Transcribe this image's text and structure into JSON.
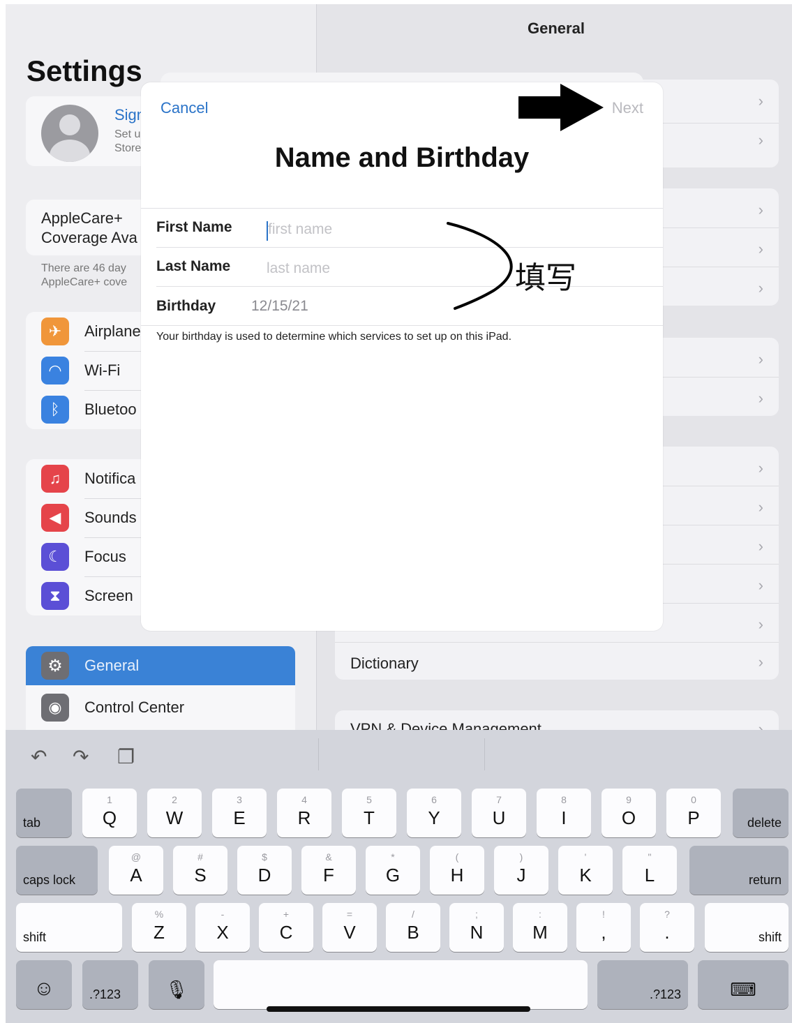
{
  "settings": {
    "title": "Settings",
    "account": {
      "title_partial": "Sign",
      "line1_partial": "Set u",
      "line2_partial": "Store"
    },
    "applecare": {
      "line1": "AppleCare+",
      "line2_partial": "Coverage Ava",
      "note1_partial": "There are 46 day",
      "note2_partial": "AppleCare+ cove"
    },
    "group1": [
      {
        "label": "Airplane",
        "icon": "airplane-icon",
        "color": "#f0963a",
        "glyph": "✈"
      },
      {
        "label": "Wi-Fi",
        "icon": "wifi-icon",
        "color": "#3a82e0",
        "glyph": "◠"
      },
      {
        "label": "Bluetoo",
        "icon": "bluetooth-icon",
        "color": "#3a82e0",
        "glyph": "ᛒ"
      }
    ],
    "group2": [
      {
        "label": "Notifica",
        "icon": "notifications-icon",
        "color": "#e5444a",
        "glyph": "♫"
      },
      {
        "label": "Sounds",
        "icon": "sounds-icon",
        "color": "#e5444a",
        "glyph": "◀"
      },
      {
        "label": "Focus",
        "icon": "focus-icon",
        "color": "#5b4fd6",
        "glyph": "☾"
      },
      {
        "label": "Screen",
        "icon": "screen-time-icon",
        "color": "#5b4fd6",
        "glyph": "⧗"
      }
    ],
    "group3": [
      {
        "label": "General",
        "icon": "gear-icon",
        "glyph": "⚙"
      },
      {
        "label": "Control Center",
        "icon": "control-center-icon",
        "glyph": "◉"
      }
    ]
  },
  "detail": {
    "title": "General",
    "dictionary": "Dictionary",
    "vpn_partial": "VPN & Device Management"
  },
  "modal": {
    "cancel": "Cancel",
    "next": "Next",
    "title": "Name and Birthday",
    "first_name_label": "First Name",
    "first_name_placeholder": "first name",
    "last_name_label": "Last Name",
    "last_name_placeholder": "last name",
    "birthday_label": "Birthday",
    "birthday_value": "12/15/21",
    "footnote": "Your birthday is used to determine which services to set up on this iPad."
  },
  "annotation": {
    "text": "填写"
  },
  "keyboard": {
    "row1": [
      [
        "Q",
        "1"
      ],
      [
        "W",
        "2"
      ],
      [
        "E",
        "3"
      ],
      [
        "R",
        "4"
      ],
      [
        "T",
        "5"
      ],
      [
        "Y",
        "6"
      ],
      [
        "U",
        "7"
      ],
      [
        "I",
        "8"
      ],
      [
        "O",
        "9"
      ],
      [
        "P",
        "0"
      ]
    ],
    "row2": [
      [
        "A",
        "@"
      ],
      [
        "S",
        "#"
      ],
      [
        "D",
        "$"
      ],
      [
        "F",
        "&"
      ],
      [
        "G",
        "*"
      ],
      [
        "H",
        "("
      ],
      [
        "J",
        ")"
      ],
      [
        "K",
        "'"
      ],
      [
        "L",
        "\""
      ]
    ],
    "row3": [
      [
        "Z",
        "%"
      ],
      [
        "X",
        "-"
      ],
      [
        "C",
        "+"
      ],
      [
        "V",
        "="
      ],
      [
        "B",
        "/"
      ],
      [
        "N",
        ";"
      ],
      [
        "M",
        ":"
      ],
      [
        ",",
        "!"
      ],
      [
        ".",
        "?"
      ]
    ],
    "tab": "tab",
    "delete": "delete",
    "caps_lock": "caps lock",
    "return": "return",
    "shift": "shift",
    "numbers": ".?123"
  }
}
